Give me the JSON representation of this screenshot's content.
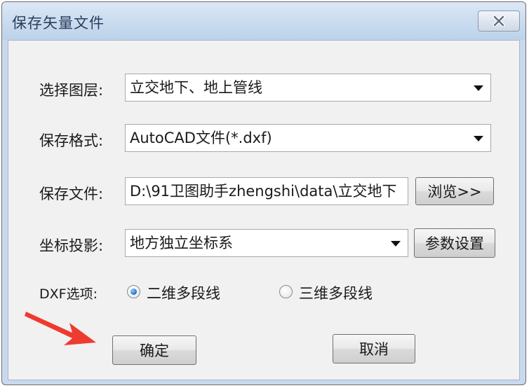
{
  "window": {
    "title": "保存矢量文件"
  },
  "form": {
    "layer": {
      "label": "选择图层:",
      "value": "立交地下、地上管线"
    },
    "format": {
      "label": "保存格式:",
      "value": "AutoCAD文件(*.dxf)"
    },
    "file": {
      "label": "保存文件:",
      "value": "D:\\91卫图助手zhengshi\\data\\立交地下",
      "browse_label": "浏览>>"
    },
    "projection": {
      "label": "坐标投影:",
      "value": "地方独立坐标系",
      "settings_label": "参数设置"
    },
    "dxf": {
      "label": "DXF选项:",
      "options": [
        {
          "label": "二维多段线",
          "selected": true
        },
        {
          "label": "三维多段线",
          "selected": false
        }
      ]
    }
  },
  "buttons": {
    "ok_label": "确定",
    "cancel_label": "取消"
  },
  "colors": {
    "annotation_arrow": "#ee3b2f",
    "radio_selected": "#1d6fc2"
  }
}
